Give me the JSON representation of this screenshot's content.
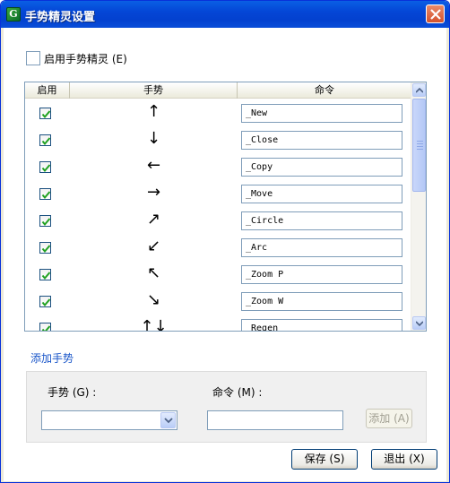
{
  "window": {
    "title": "手势精灵设置",
    "app_icon_letter": "G"
  },
  "enable_gestures": {
    "label": "启用手势精灵 (E)",
    "checked": false
  },
  "grid": {
    "columns": [
      "启用",
      "手势",
      "命令"
    ],
    "rows": [
      {
        "enabled": true,
        "gesture": "↑",
        "command": "_New"
      },
      {
        "enabled": true,
        "gesture": "↓",
        "command": "_Close"
      },
      {
        "enabled": true,
        "gesture": "←",
        "command": "_Copy"
      },
      {
        "enabled": true,
        "gesture": "→",
        "command": "_Move"
      },
      {
        "enabled": true,
        "gesture": "↗",
        "command": "_Circle"
      },
      {
        "enabled": true,
        "gesture": "↙",
        "command": "_Arc"
      },
      {
        "enabled": true,
        "gesture": "↖",
        "command": "_Zoom P"
      },
      {
        "enabled": true,
        "gesture": "↘",
        "command": "_Zoom W"
      },
      {
        "enabled": true,
        "gesture": "↑↓",
        "command": "_Regen"
      }
    ]
  },
  "add_section": {
    "title": "添加手势",
    "gesture_label": "手势 (G) :",
    "command_label": "命令 (M) :",
    "gesture_value": "",
    "command_value": "",
    "add_label": "添加 (A)"
  },
  "buttons": {
    "save": "保存 (S)",
    "exit": "退出 (X)"
  },
  "colors": {
    "titlebar": "#0446d6",
    "link": "#1a56c9",
    "check": "#21a121"
  }
}
